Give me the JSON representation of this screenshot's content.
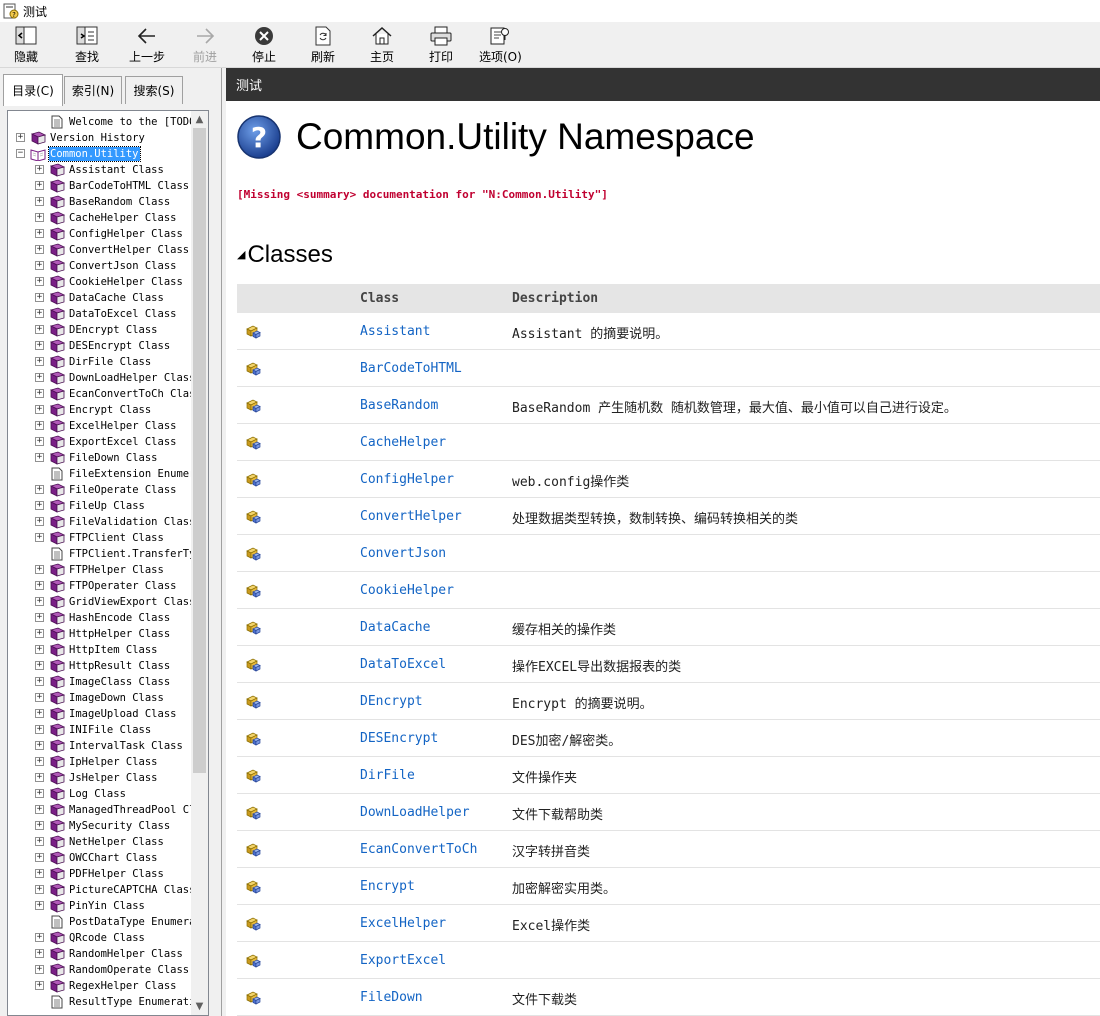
{
  "window": {
    "title": "测试"
  },
  "toolbar": {
    "buttons": [
      {
        "label": "隐藏",
        "icon": "hide-icon",
        "enabled": true
      },
      {
        "label": "查找",
        "icon": "locate-icon",
        "enabled": true
      },
      {
        "label": "上一步",
        "icon": "back-arrow-icon",
        "enabled": true
      },
      {
        "label": "前进",
        "icon": "forward-arrow-icon",
        "enabled": false
      },
      {
        "label": "停止",
        "icon": "stop-icon",
        "enabled": true
      },
      {
        "label": "刷新",
        "icon": "refresh-icon",
        "enabled": true
      },
      {
        "label": "主页",
        "icon": "home-icon",
        "enabled": true
      },
      {
        "label": "打印",
        "icon": "print-icon",
        "enabled": true
      },
      {
        "label": "选项(O)",
        "icon": "options-icon",
        "enabled": true
      }
    ]
  },
  "nav_tabs": [
    {
      "label": "目录(C)",
      "active": true
    },
    {
      "label": "索引(N)",
      "active": false
    },
    {
      "label": "搜索(S)",
      "active": false
    }
  ],
  "tree": {
    "items": [
      {
        "label": "Welcome to the [TODO: A",
        "level": 1,
        "type": "page",
        "expander": false
      },
      {
        "label": "Version History",
        "level": 0,
        "type": "book",
        "expander": true
      },
      {
        "label": "Common.Utility",
        "level": 0,
        "type": "book-open",
        "expander": "minus",
        "selected": true
      },
      {
        "label": "Assistant Class",
        "level": 1,
        "type": "book",
        "expander": true
      },
      {
        "label": "BarCodeToHTML Class",
        "level": 1,
        "type": "book",
        "expander": true
      },
      {
        "label": "BaseRandom Class",
        "level": 1,
        "type": "book",
        "expander": true
      },
      {
        "label": "CacheHelper Class",
        "level": 1,
        "type": "book",
        "expander": true
      },
      {
        "label": "ConfigHelper Class",
        "level": 1,
        "type": "book",
        "expander": true
      },
      {
        "label": "ConvertHelper Class",
        "level": 1,
        "type": "book",
        "expander": true
      },
      {
        "label": "ConvertJson Class",
        "level": 1,
        "type": "book",
        "expander": true
      },
      {
        "label": "CookieHelper Class",
        "level": 1,
        "type": "book",
        "expander": true
      },
      {
        "label": "DataCache Class",
        "level": 1,
        "type": "book",
        "expander": true
      },
      {
        "label": "DataToExcel Class",
        "level": 1,
        "type": "book",
        "expander": true
      },
      {
        "label": "DEncrypt Class",
        "level": 1,
        "type": "book",
        "expander": true
      },
      {
        "label": "DESEncrypt Class",
        "level": 1,
        "type": "book",
        "expander": true
      },
      {
        "label": "DirFile Class",
        "level": 1,
        "type": "book",
        "expander": true
      },
      {
        "label": "DownLoadHelper Class",
        "level": 1,
        "type": "book",
        "expander": true
      },
      {
        "label": "EcanConvertToCh Clas",
        "level": 1,
        "type": "book",
        "expander": true
      },
      {
        "label": "Encrypt Class",
        "level": 1,
        "type": "book",
        "expander": true
      },
      {
        "label": "ExcelHelper Class",
        "level": 1,
        "type": "book",
        "expander": true
      },
      {
        "label": "ExportExcel Class",
        "level": 1,
        "type": "book",
        "expander": true
      },
      {
        "label": "FileDown Class",
        "level": 1,
        "type": "book",
        "expander": true
      },
      {
        "label": "FileExtension Enumer",
        "level": 1,
        "type": "page",
        "expander": false
      },
      {
        "label": "FileOperate Class",
        "level": 1,
        "type": "book",
        "expander": true
      },
      {
        "label": "FileUp Class",
        "level": 1,
        "type": "book",
        "expander": true
      },
      {
        "label": "FileValidation Class",
        "level": 1,
        "type": "book",
        "expander": true
      },
      {
        "label": "FTPClient Class",
        "level": 1,
        "type": "book",
        "expander": true
      },
      {
        "label": "FTPClient.TransferTy",
        "level": 1,
        "type": "page",
        "expander": false
      },
      {
        "label": "FTPHelper Class",
        "level": 1,
        "type": "book",
        "expander": true
      },
      {
        "label": "FTPOperater Class",
        "level": 1,
        "type": "book",
        "expander": true
      },
      {
        "label": "GridViewExport Class",
        "level": 1,
        "type": "book",
        "expander": true
      },
      {
        "label": "HashEncode Class",
        "level": 1,
        "type": "book",
        "expander": true
      },
      {
        "label": "HttpHelper Class",
        "level": 1,
        "type": "book",
        "expander": true
      },
      {
        "label": "HttpItem Class",
        "level": 1,
        "type": "book",
        "expander": true
      },
      {
        "label": "HttpResult Class",
        "level": 1,
        "type": "book",
        "expander": true
      },
      {
        "label": "ImageClass Class",
        "level": 1,
        "type": "book",
        "expander": true
      },
      {
        "label": "ImageDown Class",
        "level": 1,
        "type": "book",
        "expander": true
      },
      {
        "label": "ImageUpload Class",
        "level": 1,
        "type": "book",
        "expander": true
      },
      {
        "label": "INIFile Class",
        "level": 1,
        "type": "book",
        "expander": true
      },
      {
        "label": "IntervalTask Class",
        "level": 1,
        "type": "book",
        "expander": true
      },
      {
        "label": "IpHelper Class",
        "level": 1,
        "type": "book",
        "expander": true
      },
      {
        "label": "JsHelper Class",
        "level": 1,
        "type": "book",
        "expander": true
      },
      {
        "label": "Log Class",
        "level": 1,
        "type": "book",
        "expander": true
      },
      {
        "label": "ManagedThreadPool Cl",
        "level": 1,
        "type": "book",
        "expander": true
      },
      {
        "label": "MySecurity Class",
        "level": 1,
        "type": "book",
        "expander": true
      },
      {
        "label": "NetHelper Class",
        "level": 1,
        "type": "book",
        "expander": true
      },
      {
        "label": "OWCChart Class",
        "level": 1,
        "type": "book",
        "expander": true
      },
      {
        "label": "PDFHelper Class",
        "level": 1,
        "type": "book",
        "expander": true
      },
      {
        "label": "PictureCAPTCHA Class",
        "level": 1,
        "type": "book",
        "expander": true
      },
      {
        "label": "PinYin Class",
        "level": 1,
        "type": "book",
        "expander": true
      },
      {
        "label": "PostDataType Enumera",
        "level": 1,
        "type": "page",
        "expander": false
      },
      {
        "label": "QRcode Class",
        "level": 1,
        "type": "book",
        "expander": true
      },
      {
        "label": "RandomHelper Class",
        "level": 1,
        "type": "book",
        "expander": true
      },
      {
        "label": "RandomOperate Class",
        "level": 1,
        "type": "book",
        "expander": true
      },
      {
        "label": "RegexHelper Class",
        "level": 1,
        "type": "book",
        "expander": true
      },
      {
        "label": "ResultType Enumerati",
        "level": 1,
        "type": "page",
        "expander": false
      }
    ]
  },
  "content": {
    "header": "测试",
    "title": "Common.Utility Namespace",
    "missing_summary": "[Missing <summary> documentation for \"N:Common.Utility\"]",
    "section_title": "Classes",
    "columns": {
      "class": "Class",
      "description": "Description"
    },
    "classes": [
      {
        "name": "Assistant",
        "description": "Assistant 的摘要说明。"
      },
      {
        "name": "BarCodeToHTML",
        "description": ""
      },
      {
        "name": "BaseRandom",
        "description": "BaseRandom 产生随机数 随机数管理，最大值、最小值可以自己进行设定。"
      },
      {
        "name": "CacheHelper",
        "description": ""
      },
      {
        "name": "ConfigHelper",
        "description": "web.config操作类"
      },
      {
        "name": "ConvertHelper",
        "description": "处理数据类型转换，数制转换、编码转换相关的类"
      },
      {
        "name": "ConvertJson",
        "description": ""
      },
      {
        "name": "CookieHelper",
        "description": ""
      },
      {
        "name": "DataCache",
        "description": "缓存相关的操作类"
      },
      {
        "name": "DataToExcel",
        "description": "操作EXCEL导出数据报表的类"
      },
      {
        "name": "DEncrypt",
        "description": "Encrypt 的摘要说明。"
      },
      {
        "name": "DESEncrypt",
        "description": "DES加密/解密类。"
      },
      {
        "name": "DirFile",
        "description": "文件操作夹"
      },
      {
        "name": "DownLoadHelper",
        "description": "文件下载帮助类"
      },
      {
        "name": "EcanConvertToCh",
        "description": "汉字转拼音类"
      },
      {
        "name": "Encrypt",
        "description": "加密解密实用类。"
      },
      {
        "name": "ExcelHelper",
        "description": "Excel操作类"
      },
      {
        "name": "ExportExcel",
        "description": ""
      },
      {
        "name": "FileDown",
        "description": "文件下载类"
      }
    ]
  },
  "colors": {
    "header_bg": "#333333",
    "link": "#1364c4",
    "missing": "#c00030",
    "selection": "#3399ff",
    "book": "#7a1f86"
  }
}
